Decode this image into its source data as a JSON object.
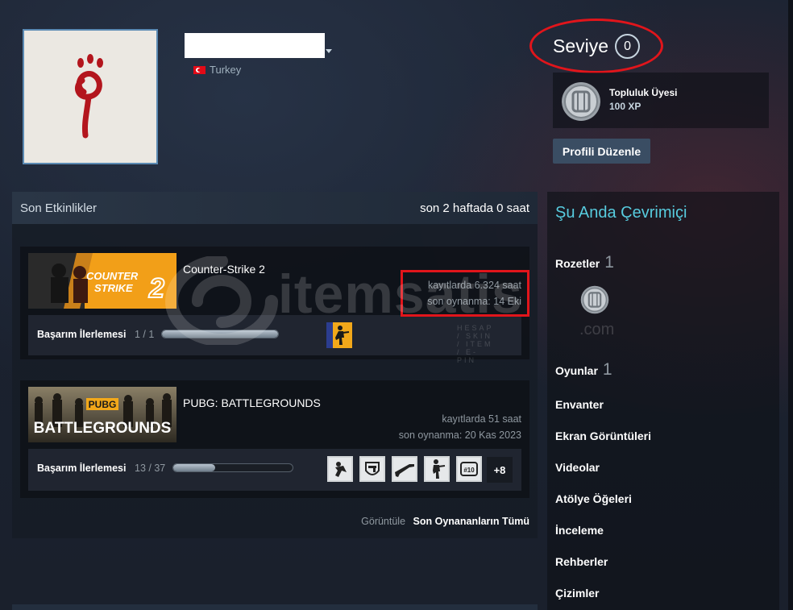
{
  "profile": {
    "country": "Turkey",
    "level_label": "Seviye",
    "level_value": "0",
    "badge": {
      "name": "Topluluk Üyesi",
      "xp": "100 XP"
    },
    "edit_button": "Profili Düzenle"
  },
  "activity": {
    "title": "Son Etkinlikler",
    "hours_summary": "son 2 haftada 0 saat",
    "games": [
      {
        "name": "Counter-Strike 2",
        "capsule_text": [
          "COUNTER",
          "STRIKE",
          "2"
        ],
        "hours_on_record": "kayıtlarda 6.324 saat",
        "last_played": "son oynanma: 14 Eki",
        "achievement_label": "Başarım İlerlemesi",
        "achievement_count": "1 / 1",
        "achievement_progress": 1.0
      },
      {
        "name": "PUBG: BATTLEGROUNDS",
        "capsule_text": [
          "PUBG",
          "BATTLEGROUNDS"
        ],
        "hours_on_record": "kayıtlarda 51 saat",
        "last_played": "son oynanma: 20 Kas 2023",
        "achievement_label": "Başarım İlerlemesi",
        "achievement_count": "13 / 37",
        "achievement_progress": 0.35,
        "more_achievements": "+8"
      }
    ],
    "view_all_prefix": "Görüntüle",
    "view_all_link": "Son Oynananların Tümü"
  },
  "sidebar": {
    "online_status": "Şu Anda Çevrimiçi",
    "badges_label": "Rozetler",
    "badges_count": "1",
    "games_label": "Oyunlar",
    "games_count": "1",
    "links": [
      "Envanter",
      "Ekran Görüntüleri",
      "Videolar",
      "Atölye Öğeleri",
      "İnceleme",
      "Rehberler",
      "Çizimler"
    ]
  },
  "watermark": {
    "brand": "itemsatis",
    "tagline": "HESAP / SKIN / ITEM / E-PIN",
    "domain": ".com"
  },
  "colors": {
    "highlight": "#e1151b",
    "online": "#57cbde",
    "cs2_orange": "#f29f18"
  }
}
